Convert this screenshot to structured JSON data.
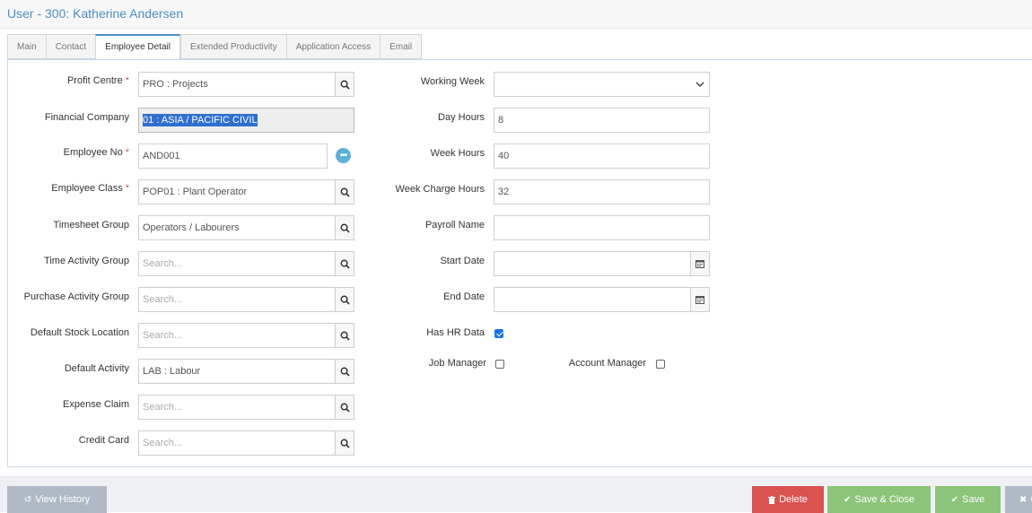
{
  "window": {
    "title": "User - 300: Katherine Andersen"
  },
  "tabs": [
    {
      "label": "Main",
      "active": false
    },
    {
      "label": "Contact",
      "active": false
    },
    {
      "label": "Employee Detail",
      "active": true
    },
    {
      "label": "Extended Productivity",
      "active": false
    },
    {
      "label": "Application Access",
      "active": false
    },
    {
      "label": "Email",
      "active": false
    }
  ],
  "left_fields": {
    "profit_centre": {
      "label": "Profit Centre",
      "value": "PRO : Projects",
      "required": true
    },
    "financial_company": {
      "label": "Financial Company",
      "value": "01 : ASIA / PACIFIC CIVIL"
    },
    "employee_no": {
      "label": "Employee No",
      "value": "AND001",
      "required": true
    },
    "employee_class": {
      "label": "Employee Class",
      "value": "POP01 : Plant Operator",
      "required": true
    },
    "timesheet_group": {
      "label": "Timesheet Group",
      "value": "Operators / Labourers"
    },
    "time_activity_group": {
      "label": "Time Activity Group",
      "placeholder": "Search..."
    },
    "purchase_activity_group": {
      "label": "Purchase Activity Group",
      "placeholder": "Search..."
    },
    "default_stock_location": {
      "label": "Default Stock Location",
      "placeholder": "Search..."
    },
    "default_activity": {
      "label": "Default Activity",
      "value": "LAB : Labour"
    },
    "expense_claim": {
      "label": "Expense Claim",
      "placeholder": "Search..."
    },
    "credit_card": {
      "label": "Credit Card",
      "placeholder": "Search..."
    }
  },
  "right_fields": {
    "working_week": {
      "label": "Working Week",
      "value": ""
    },
    "day_hours": {
      "label": "Day Hours",
      "value": "8"
    },
    "week_hours": {
      "label": "Week Hours",
      "value": "40"
    },
    "week_charge_hours": {
      "label": "Week Charge Hours",
      "value": "32"
    },
    "payroll_name": {
      "label": "Payroll Name",
      "value": ""
    },
    "start_date": {
      "label": "Start Date",
      "value": ""
    },
    "end_date": {
      "label": "End Date",
      "value": ""
    },
    "has_hr_data": {
      "label": "Has HR Data",
      "checked": true
    },
    "job_manager": {
      "label": "Job Manager",
      "checked": false
    },
    "account_manager": {
      "label": "Account Manager",
      "checked": false
    }
  },
  "footer": {
    "view_history": "View History",
    "delete": "Delete",
    "save_close": "Save & Close",
    "save": "Save",
    "close": "C"
  },
  "colors": {
    "accent": "#4a8ec2",
    "required": "#d9534f",
    "delete": "#d9534f",
    "save": "#8cc47a",
    "neutral_button": "#b0bac6"
  },
  "icons": {
    "lookup": "search-icon",
    "more": "ellipsis-icon",
    "dropdown": "chevron-down-icon",
    "date": "calendar-icon",
    "history": "history-icon",
    "delete": "trash-icon",
    "save": "checkmark-icon",
    "close": "close-icon"
  }
}
